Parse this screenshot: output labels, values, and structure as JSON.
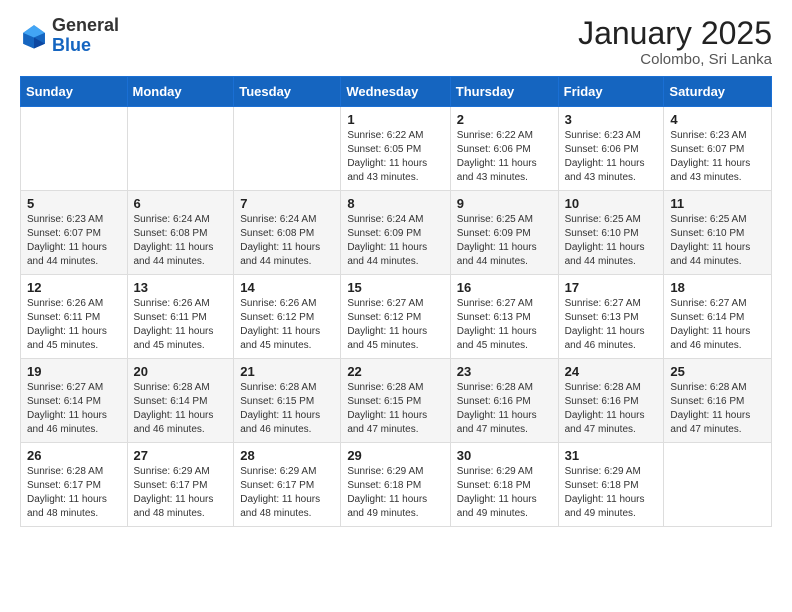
{
  "logo": {
    "general": "General",
    "blue": "Blue"
  },
  "header": {
    "month": "January 2025",
    "location": "Colombo, Sri Lanka"
  },
  "weekdays": [
    "Sunday",
    "Monday",
    "Tuesday",
    "Wednesday",
    "Thursday",
    "Friday",
    "Saturday"
  ],
  "weeks": [
    [
      {
        "day": "",
        "info": ""
      },
      {
        "day": "",
        "info": ""
      },
      {
        "day": "",
        "info": ""
      },
      {
        "day": "1",
        "info": "Sunrise: 6:22 AM\nSunset: 6:05 PM\nDaylight: 11 hours and 43 minutes."
      },
      {
        "day": "2",
        "info": "Sunrise: 6:22 AM\nSunset: 6:06 PM\nDaylight: 11 hours and 43 minutes."
      },
      {
        "day": "3",
        "info": "Sunrise: 6:23 AM\nSunset: 6:06 PM\nDaylight: 11 hours and 43 minutes."
      },
      {
        "day": "4",
        "info": "Sunrise: 6:23 AM\nSunset: 6:07 PM\nDaylight: 11 hours and 43 minutes."
      }
    ],
    [
      {
        "day": "5",
        "info": "Sunrise: 6:23 AM\nSunset: 6:07 PM\nDaylight: 11 hours and 44 minutes."
      },
      {
        "day": "6",
        "info": "Sunrise: 6:24 AM\nSunset: 6:08 PM\nDaylight: 11 hours and 44 minutes."
      },
      {
        "day": "7",
        "info": "Sunrise: 6:24 AM\nSunset: 6:08 PM\nDaylight: 11 hours and 44 minutes."
      },
      {
        "day": "8",
        "info": "Sunrise: 6:24 AM\nSunset: 6:09 PM\nDaylight: 11 hours and 44 minutes."
      },
      {
        "day": "9",
        "info": "Sunrise: 6:25 AM\nSunset: 6:09 PM\nDaylight: 11 hours and 44 minutes."
      },
      {
        "day": "10",
        "info": "Sunrise: 6:25 AM\nSunset: 6:10 PM\nDaylight: 11 hours and 44 minutes."
      },
      {
        "day": "11",
        "info": "Sunrise: 6:25 AM\nSunset: 6:10 PM\nDaylight: 11 hours and 44 minutes."
      }
    ],
    [
      {
        "day": "12",
        "info": "Sunrise: 6:26 AM\nSunset: 6:11 PM\nDaylight: 11 hours and 45 minutes."
      },
      {
        "day": "13",
        "info": "Sunrise: 6:26 AM\nSunset: 6:11 PM\nDaylight: 11 hours and 45 minutes."
      },
      {
        "day": "14",
        "info": "Sunrise: 6:26 AM\nSunset: 6:12 PM\nDaylight: 11 hours and 45 minutes."
      },
      {
        "day": "15",
        "info": "Sunrise: 6:27 AM\nSunset: 6:12 PM\nDaylight: 11 hours and 45 minutes."
      },
      {
        "day": "16",
        "info": "Sunrise: 6:27 AM\nSunset: 6:13 PM\nDaylight: 11 hours and 45 minutes."
      },
      {
        "day": "17",
        "info": "Sunrise: 6:27 AM\nSunset: 6:13 PM\nDaylight: 11 hours and 46 minutes."
      },
      {
        "day": "18",
        "info": "Sunrise: 6:27 AM\nSunset: 6:14 PM\nDaylight: 11 hours and 46 minutes."
      }
    ],
    [
      {
        "day": "19",
        "info": "Sunrise: 6:27 AM\nSunset: 6:14 PM\nDaylight: 11 hours and 46 minutes."
      },
      {
        "day": "20",
        "info": "Sunrise: 6:28 AM\nSunset: 6:14 PM\nDaylight: 11 hours and 46 minutes."
      },
      {
        "day": "21",
        "info": "Sunrise: 6:28 AM\nSunset: 6:15 PM\nDaylight: 11 hours and 46 minutes."
      },
      {
        "day": "22",
        "info": "Sunrise: 6:28 AM\nSunset: 6:15 PM\nDaylight: 11 hours and 47 minutes."
      },
      {
        "day": "23",
        "info": "Sunrise: 6:28 AM\nSunset: 6:16 PM\nDaylight: 11 hours and 47 minutes."
      },
      {
        "day": "24",
        "info": "Sunrise: 6:28 AM\nSunset: 6:16 PM\nDaylight: 11 hours and 47 minutes."
      },
      {
        "day": "25",
        "info": "Sunrise: 6:28 AM\nSunset: 6:16 PM\nDaylight: 11 hours and 47 minutes."
      }
    ],
    [
      {
        "day": "26",
        "info": "Sunrise: 6:28 AM\nSunset: 6:17 PM\nDaylight: 11 hours and 48 minutes."
      },
      {
        "day": "27",
        "info": "Sunrise: 6:29 AM\nSunset: 6:17 PM\nDaylight: 11 hours and 48 minutes."
      },
      {
        "day": "28",
        "info": "Sunrise: 6:29 AM\nSunset: 6:17 PM\nDaylight: 11 hours and 48 minutes."
      },
      {
        "day": "29",
        "info": "Sunrise: 6:29 AM\nSunset: 6:18 PM\nDaylight: 11 hours and 49 minutes."
      },
      {
        "day": "30",
        "info": "Sunrise: 6:29 AM\nSunset: 6:18 PM\nDaylight: 11 hours and 49 minutes."
      },
      {
        "day": "31",
        "info": "Sunrise: 6:29 AM\nSunset: 6:18 PM\nDaylight: 11 hours and 49 minutes."
      },
      {
        "day": "",
        "info": ""
      }
    ]
  ]
}
